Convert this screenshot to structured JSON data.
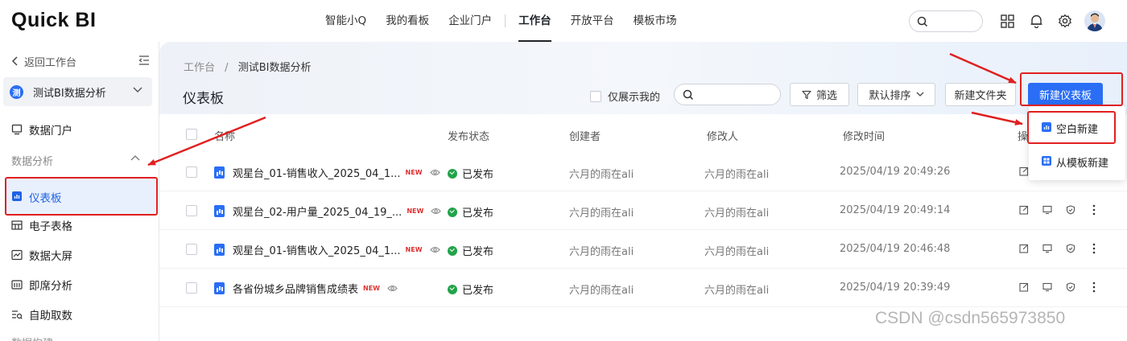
{
  "app": {
    "logo": "Quick BI"
  },
  "topnav": {
    "items": [
      "智能小Q",
      "我的看板",
      "企业门户",
      "工作台",
      "开放平台",
      "模板市场"
    ],
    "active": "工作台"
  },
  "sidebar": {
    "back_label": "返回工作台",
    "workspace": {
      "badge": "测",
      "name": "测试BI数据分析"
    },
    "portal_label": "数据门户",
    "group_label": "数据分析",
    "items": [
      "仪表板",
      "电子表格",
      "数据大屏",
      "即席分析",
      "自助取数"
    ],
    "cut_label": "数据构建"
  },
  "main": {
    "breadcrumb": {
      "root": "工作台",
      "sep": "/",
      "current": "测试BI数据分析"
    },
    "title": "仪表板",
    "only_mine": "仅展示我的",
    "filter": "筛选",
    "sort": "默认排序",
    "new_folder": "新建文件夹",
    "new_dashboard": "新建仪表板",
    "dropdown": {
      "blank": "空白新建",
      "template": "从模板新建"
    },
    "columns": {
      "name": "名称",
      "status": "发布状态",
      "creator": "创建者",
      "modifier": "修改人",
      "modified": "修改时间",
      "ops": "操"
    },
    "rows": [
      {
        "name": "观星台_01-销售收入_2025_04_1...",
        "tag": "NEW",
        "status": "已发布",
        "creator": "六月的雨在ali",
        "modifier": "六月的雨在ali",
        "time": "2025/04/19 20:49:26"
      },
      {
        "name": "观星台_02-用户量_2025_04_19_...",
        "tag": "NEW",
        "status": "已发布",
        "creator": "六月的雨在ali",
        "modifier": "六月的雨在ali",
        "time": "2025/04/19 20:49:14"
      },
      {
        "name": "观星台_01-销售收入_2025_04_1...",
        "tag": "NEW",
        "status": "已发布",
        "creator": "六月的雨在ali",
        "modifier": "六月的雨在ali",
        "time": "2025/04/19 20:46:48"
      },
      {
        "name": "各省份城乡品牌销售成绩表",
        "tag": "NEW",
        "status": "已发布",
        "creator": "六月的雨在ali",
        "modifier": "六月的雨在ali",
        "time": "2025/04/19 20:39:49"
      }
    ]
  },
  "watermark": "CSDN @csdn565973850",
  "colors": {
    "primary": "#2a6ef5",
    "annotation": "#e02020",
    "published": "#22a34a"
  }
}
